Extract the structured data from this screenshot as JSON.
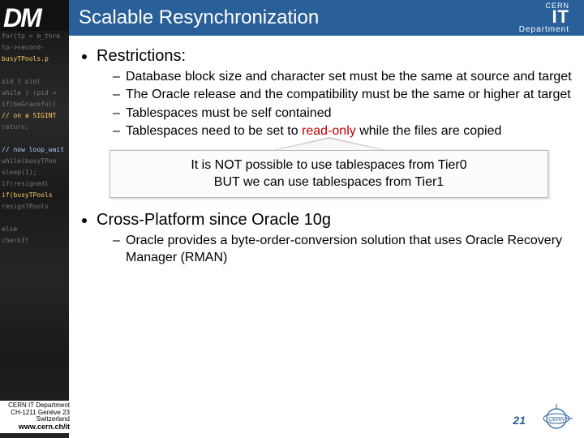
{
  "sidebar": {
    "label": "DM"
  },
  "header": {
    "title": "Scalable Resynchronization",
    "logo_top": "CERN",
    "logo_main": "IT",
    "logo_bottom": "Department"
  },
  "content": {
    "b1a": "Restrictions:",
    "sub": {
      "r1": "Database block size and character set must be the same at source and target",
      "r2": "The Oracle release and the compatibility must be the same or higher at target",
      "r3": "Tablespaces must be self contained",
      "r4a": "Tablespaces need to be set to ",
      "r4_red": "read-only",
      "r4b": " while the files are copied"
    },
    "callout": {
      "line1": "It is NOT possible to use tablespaces from Tier0",
      "line2": "BUT we can use tablespaces from Tier1"
    },
    "b1b": "Cross-Platform since Oracle 10g",
    "sub2": {
      "c1": "Oracle provides a byte-order-conversion solution that uses Oracle Recovery Manager (RMAN)"
    }
  },
  "footer": {
    "line1": "CERN IT Department",
    "line2": "CH-1211 Genève 23",
    "line3": "Switzerland",
    "url": "www.cern.ch/it"
  },
  "page": "21"
}
